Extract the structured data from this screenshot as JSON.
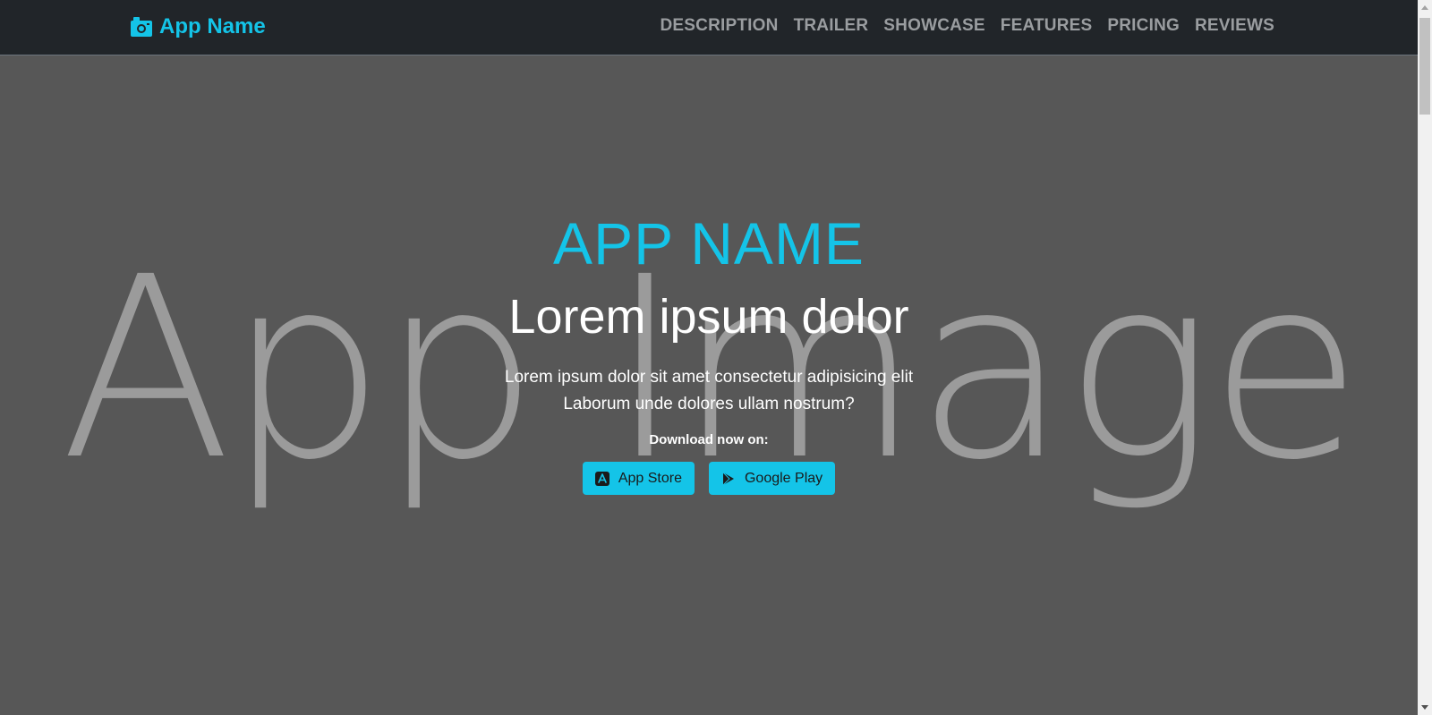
{
  "navbar": {
    "brand": {
      "label": "App Name",
      "icon": "camera-icon"
    },
    "links": [
      {
        "label": "DESCRIPTION"
      },
      {
        "label": "TRAILER"
      },
      {
        "label": "SHOWCASE"
      },
      {
        "label": "FEATURES"
      },
      {
        "label": "PRICING"
      },
      {
        "label": "REVIEWS"
      }
    ]
  },
  "hero": {
    "background_text": "App Image",
    "title": "APP NAME",
    "headline": "Lorem ipsum dolor",
    "description_line1": "Lorem ipsum dolor sit amet consectetur adipisicing elit",
    "description_line2": "Laborum unde dolores ullam nostrum?",
    "download_label": "Download now on:",
    "buttons": [
      {
        "label": "App Store",
        "icon": "app-store-icon"
      },
      {
        "label": "Google Play",
        "icon": "google-play-icon"
      }
    ]
  },
  "colors": {
    "accent": "#14c4e8",
    "navbar_bg": "#212529",
    "hero_bg": "#575757",
    "nav_link": "#9a9da0"
  }
}
